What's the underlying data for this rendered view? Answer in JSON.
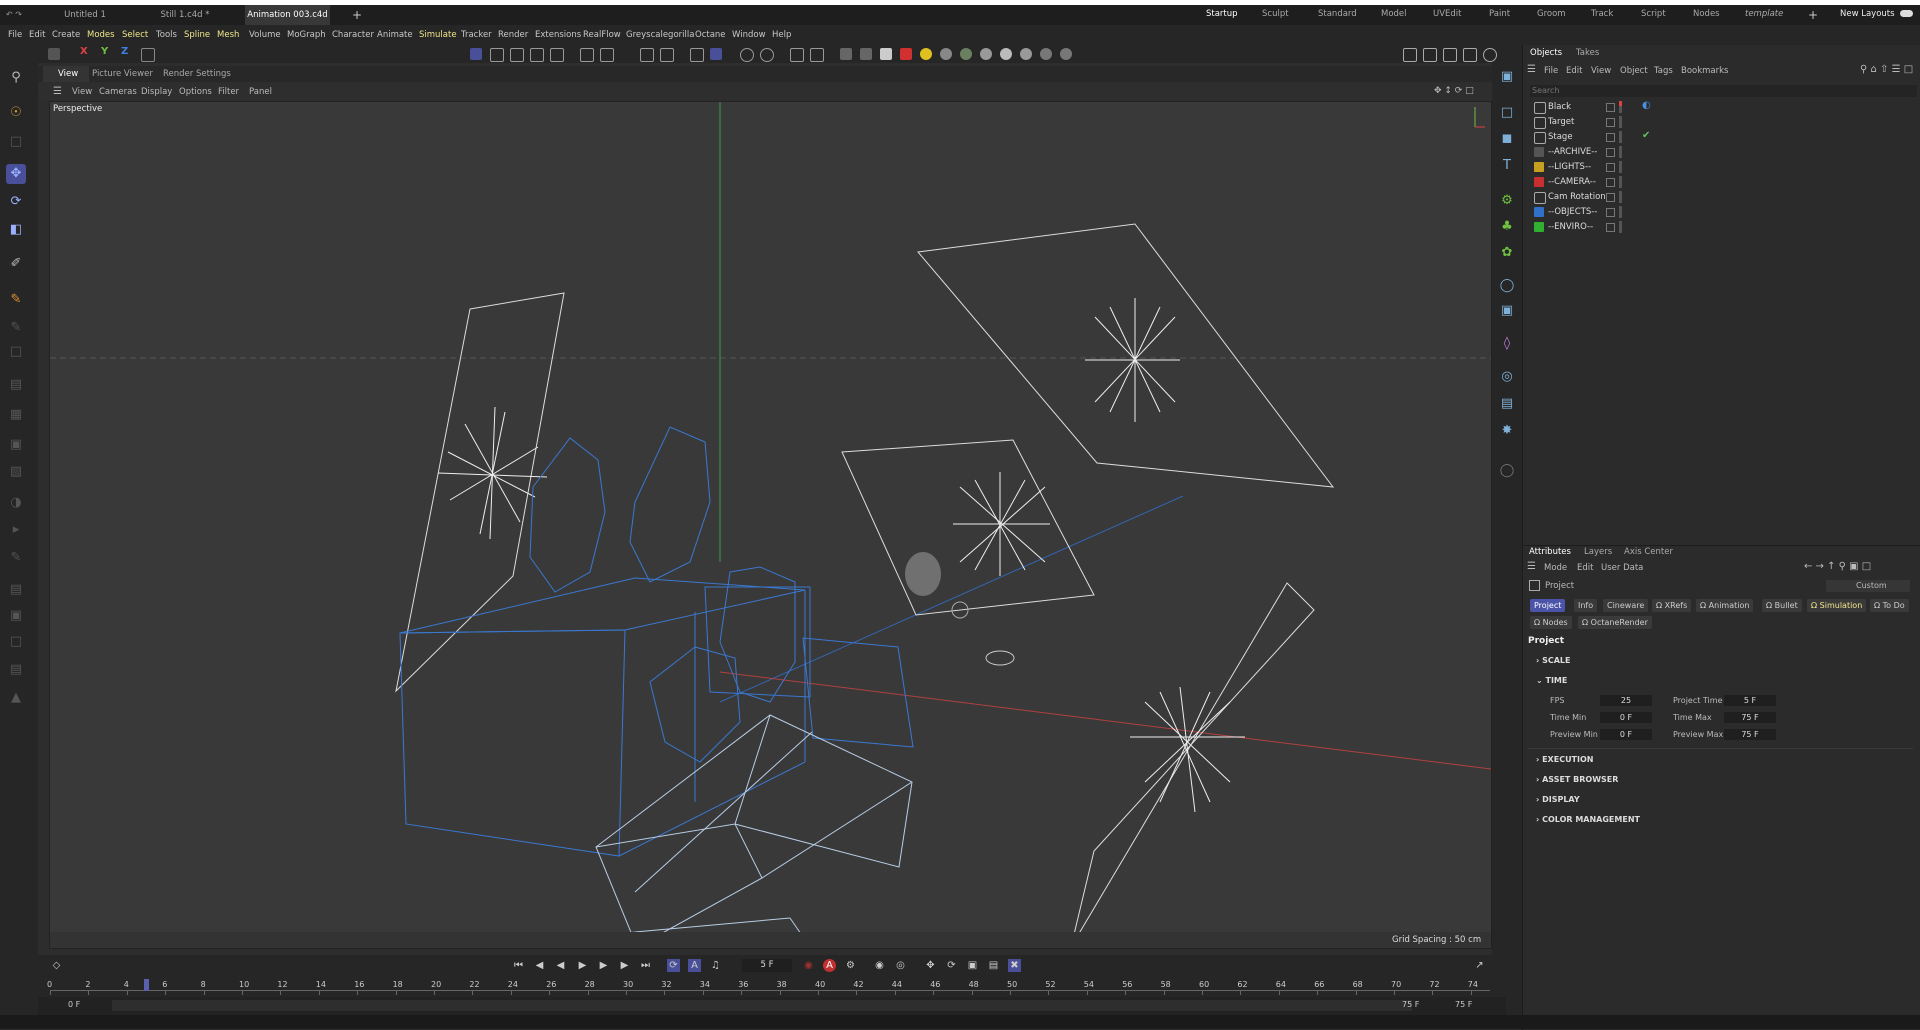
{
  "window": {
    "controls": "↶ ↷"
  },
  "doc_tabs": [
    {
      "label": "Untitled 1",
      "active": false
    },
    {
      "label": "Still 1.c4d *",
      "active": false
    },
    {
      "label": "Animation 003.c4d *",
      "active": true
    }
  ],
  "layout_tabs": [
    "Startup",
    "Sculpt",
    "Standard",
    "Model",
    "UVEdit",
    "Paint",
    "Groom",
    "Track",
    "Script",
    "Nodes",
    "template"
  ],
  "new_layouts": "New Layouts",
  "menu": [
    "File",
    "Edit",
    "Create",
    "Modes",
    "Select",
    "Tools",
    "Spline",
    "Mesh",
    "Volume",
    "MoGraph",
    "Character",
    "Animate",
    "Simulate",
    "Tracker",
    "Render",
    "Extensions",
    "RealFlow",
    "Greyscalegorilla",
    "Octane",
    "Window",
    "Help"
  ],
  "axis_buttons": [
    "X",
    "Y",
    "Z"
  ],
  "viewport": {
    "tabs": [
      "View",
      "Picture Viewer",
      "Render Settings"
    ],
    "menu": [
      "View",
      "Cameras",
      "Display",
      "Options",
      "Filter",
      "Panel"
    ],
    "label": "Perspective",
    "grid_spacing": "Grid Spacing : 50 cm"
  },
  "objects_panel": {
    "tabs": [
      "Objects",
      "Takes"
    ],
    "menu": [
      "File",
      "Edit",
      "View",
      "Object",
      "Tags",
      "Bookmarks"
    ],
    "search_placeholder": "Search",
    "items": [
      {
        "name": "Black",
        "color": "#aaaaaa",
        "tag": "◐"
      },
      {
        "name": "Target",
        "color": "#aaaaaa",
        "tag": ""
      },
      {
        "name": "Stage",
        "color": "#aaaaaa",
        "tag": "✔"
      },
      {
        "name": "--ARCHIVE--",
        "color": "#555555",
        "tag": ""
      },
      {
        "name": "--LIGHTS--",
        "color": "#c8a020",
        "tag": ""
      },
      {
        "name": "--CAMERA--",
        "color": "#c83030",
        "tag": ""
      },
      {
        "name": "Cam Rotation",
        "color": "#aaaaaa",
        "tag": ""
      },
      {
        "name": "--OBJECTS--",
        "color": "#3070c8",
        "tag": ""
      },
      {
        "name": "--ENVIRO--",
        "color": "#30b030",
        "tag": ""
      }
    ]
  },
  "attributes_panel": {
    "tabs": [
      "Attributes",
      "Layers",
      "Axis Center"
    ],
    "menu": [
      "Mode",
      "Edit",
      "User Data"
    ],
    "object_label": "Project",
    "dropdown": "Custom",
    "sub_tabs": [
      "Project",
      "Info",
      "Cineware",
      "Ω XRefs",
      "Ω Animation",
      "Ω Bullet",
      "Ω Simulation",
      "Ω To Do",
      "Ω Nodes",
      "Ω OctaneRender"
    ],
    "heading": "Project",
    "sections": [
      "SCALE",
      "TIME",
      "EXECUTION",
      "ASSET BROWSER",
      "DISPLAY",
      "COLOR MANAGEMENT"
    ],
    "time": {
      "fps_label": "FPS",
      "fps": "25",
      "project_time_label": "Project Time",
      "project_time": "5 F",
      "time_min_label": "Time Min",
      "time_min": "0 F",
      "time_max_label": "Time Max",
      "time_max": "75 F",
      "preview_min_label": "Preview Min",
      "preview_min": "0 F",
      "preview_max_label": "Preview Max",
      "preview_max": "75 F"
    }
  },
  "timeline": {
    "current_frame": "5 F",
    "ticks": [
      "0",
      "2",
      "4",
      "6",
      "8",
      "10",
      "12",
      "14",
      "16",
      "18",
      "20",
      "22",
      "24",
      "26",
      "28",
      "30",
      "32",
      "34",
      "36",
      "38",
      "40",
      "42",
      "44",
      "46",
      "48",
      "50",
      "52",
      "54",
      "56",
      "58",
      "60",
      "62",
      "64",
      "66",
      "68",
      "70",
      "72",
      "74"
    ],
    "playhead_frame": 5,
    "range_start": "0 F",
    "range_start2": "0 F",
    "range_end": "75 F",
    "range_end2": "75 F"
  }
}
